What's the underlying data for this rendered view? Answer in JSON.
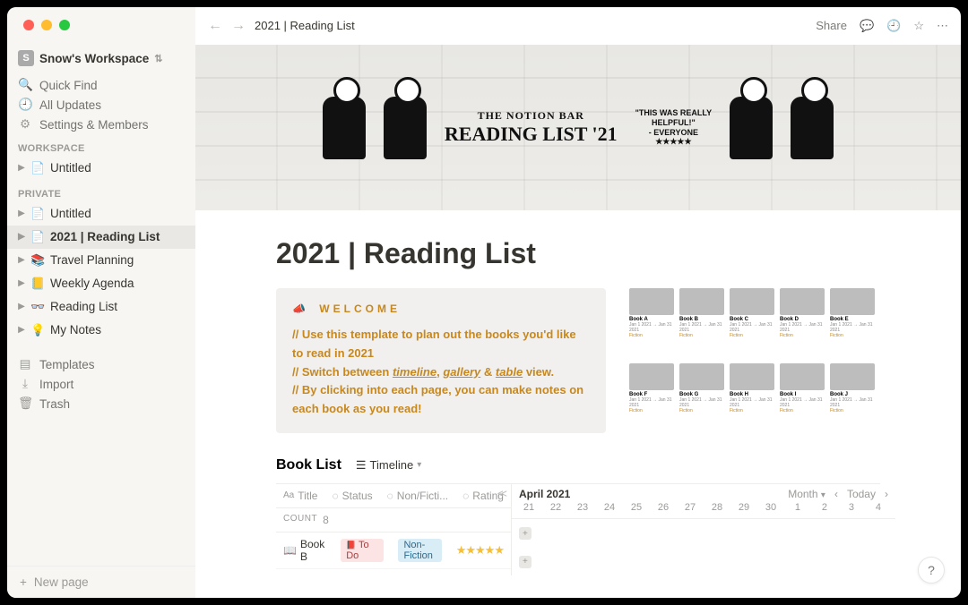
{
  "workspace": {
    "badge": "S",
    "name": "Snow's Workspace"
  },
  "sidebar": {
    "quick_find": "Quick Find",
    "all_updates": "All Updates",
    "settings": "Settings & Members",
    "section_workspace": "WORKSPACE",
    "section_private": "PRIVATE",
    "workspace_pages": [
      {
        "icon": "📄",
        "label": "Untitled"
      }
    ],
    "private_pages": [
      {
        "icon": "📄",
        "label": "Untitled"
      },
      {
        "icon": "📄",
        "label": "2021 | Reading List",
        "active": true
      },
      {
        "icon": "📚",
        "label": "Travel Planning"
      },
      {
        "icon": "📒",
        "label": "Weekly Agenda"
      },
      {
        "icon": "👓",
        "label": "Reading List"
      },
      {
        "icon": "💡",
        "label": "My Notes"
      }
    ],
    "templates": "Templates",
    "import": "Import",
    "trash": "Trash",
    "new_page": "New page"
  },
  "topbar": {
    "breadcrumb": "2021 | Reading List",
    "share": "Share"
  },
  "cover": {
    "line1": "THE NOTION BAR",
    "line2": "READING LIST '21",
    "quote1": "\"THIS WAS REALLY",
    "quote2": "HELPFUL!\"",
    "quote3": "- EVERYONE",
    "stars": "★★★★★"
  },
  "page": {
    "title": "2021 | Reading List",
    "callout_heading": "WELCOME",
    "callout_l1a": "// Use this template to plan out the books you'd like to read in 2021",
    "callout_l2a": "// Switch between ",
    "callout_l2_u1": "timeline",
    "callout_l2b": ", ",
    "callout_l2_u2": "gallery",
    "callout_l2c": " & ",
    "callout_l2_u3": "table",
    "callout_l2d": " view.",
    "callout_l3a": "// By clicking into each page, you can make notes on each book as you read!"
  },
  "db": {
    "title": "Book List",
    "view_label": "Timeline",
    "columns": {
      "title": "Title",
      "status": "Status",
      "nonfic": "Non/Ficti...",
      "rating": "Rating"
    },
    "count_label": "COUNT",
    "count_value": "8",
    "row1": {
      "title": "Book B",
      "status": "To Do",
      "nonfic": "Non-Fiction",
      "rating": "★★★★★"
    },
    "timeline": {
      "month": "April 2021",
      "scale": "Month",
      "today": "Today",
      "dates": [
        "21",
        "22",
        "23",
        "24",
        "25",
        "26",
        "27",
        "28",
        "29",
        "30",
        "1",
        "2",
        "3",
        "4"
      ]
    }
  },
  "gallery": [
    {
      "title": "Book A"
    },
    {
      "title": "Book B"
    },
    {
      "title": "Book C"
    },
    {
      "title": "Book D"
    },
    {
      "title": "Book E"
    },
    {
      "title": "Book F"
    },
    {
      "title": "Book G"
    },
    {
      "title": "Book H"
    },
    {
      "title": "Book I"
    },
    {
      "title": "Book J"
    }
  ]
}
